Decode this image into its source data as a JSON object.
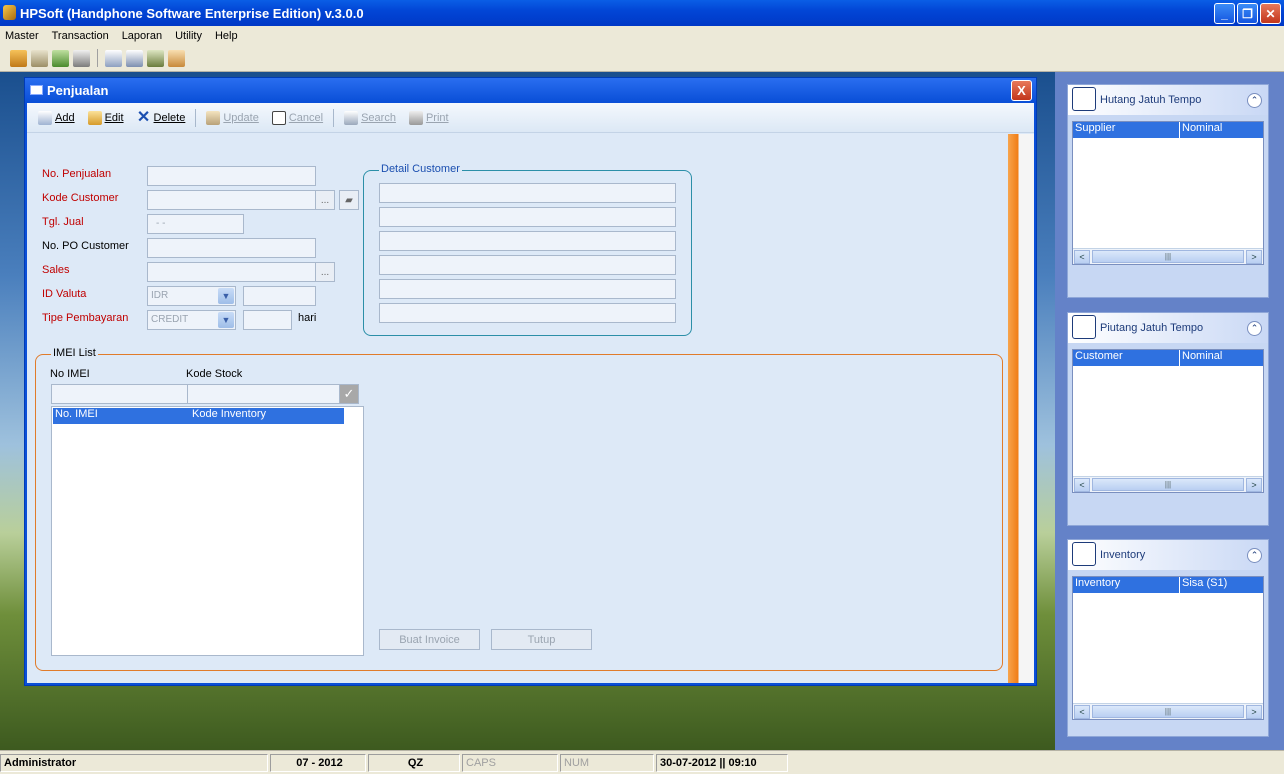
{
  "app": {
    "title": "HPSoft (Handphone Software Enterprise Edition) v.3.0.0"
  },
  "menu": [
    "Master",
    "Transaction",
    "Laporan",
    "Utility",
    "Help"
  ],
  "window": {
    "title": "Penjualan",
    "close": "X"
  },
  "toolbar": {
    "add": "Add",
    "edit": "Edit",
    "delete": "Delete",
    "update": "Update",
    "cancel": "Cancel",
    "search": "Search",
    "print": "Print"
  },
  "form": {
    "no_penjualan": "No. Penjualan",
    "kode_customer": "Kode Customer",
    "tgl_jual": "Tgl. Jual",
    "tgl_jual_value": " -  -",
    "no_po_customer": "No. PO Customer",
    "sales": "Sales",
    "id_valuta": "ID Valuta",
    "id_valuta_value": "IDR",
    "tipe_pembayaran": "Tipe Pembayaran",
    "tipe_pembayaran_value": "CREDIT",
    "hari": "hari",
    "dots": "..."
  },
  "detail_customer": {
    "legend": "Detail Customer"
  },
  "imei": {
    "legend": "IMEI List",
    "no_imei_label": "No IMEI",
    "kode_stock_label": "Kode Stock",
    "col_no_imei": "No. IMEI",
    "col_kode_inventory": "Kode Inventory"
  },
  "buttons": {
    "buat_invoice": "Buat Invoice",
    "tutup": "Tutup"
  },
  "panels": [
    {
      "title": "Hutang Jatuh Tempo",
      "col1": "Supplier",
      "col2": "Nominal"
    },
    {
      "title": "Piutang Jatuh Tempo",
      "col1": "Customer",
      "col2": "Nominal"
    },
    {
      "title": "Inventory",
      "col1": "Inventory",
      "col2": "Sisa (S1)"
    }
  ],
  "status": {
    "user": "Administrator",
    "period": "07 - 2012",
    "code": "QZ",
    "caps": "CAPS",
    "num": "NUM",
    "datetime": "30-07-2012 || 09:10"
  }
}
